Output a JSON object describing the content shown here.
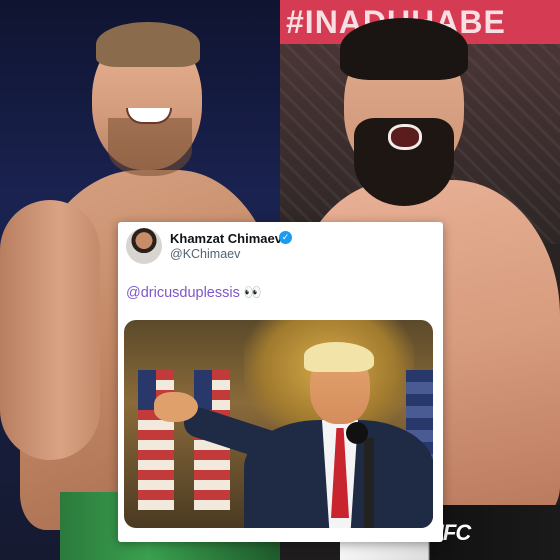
{
  "left_panel": {
    "description_icon": "fighter-left-photo"
  },
  "right_panel": {
    "banner_text": "#INADUHABE",
    "shorts_logo": "UFC"
  },
  "tweet": {
    "author_name": "Khamzat Chimaev",
    "handle": "@KChimaev",
    "mention": "@dricusduplessis",
    "emoji": "👀",
    "verified_color": "#1d9bf0",
    "mention_color": "#7b58c7"
  }
}
